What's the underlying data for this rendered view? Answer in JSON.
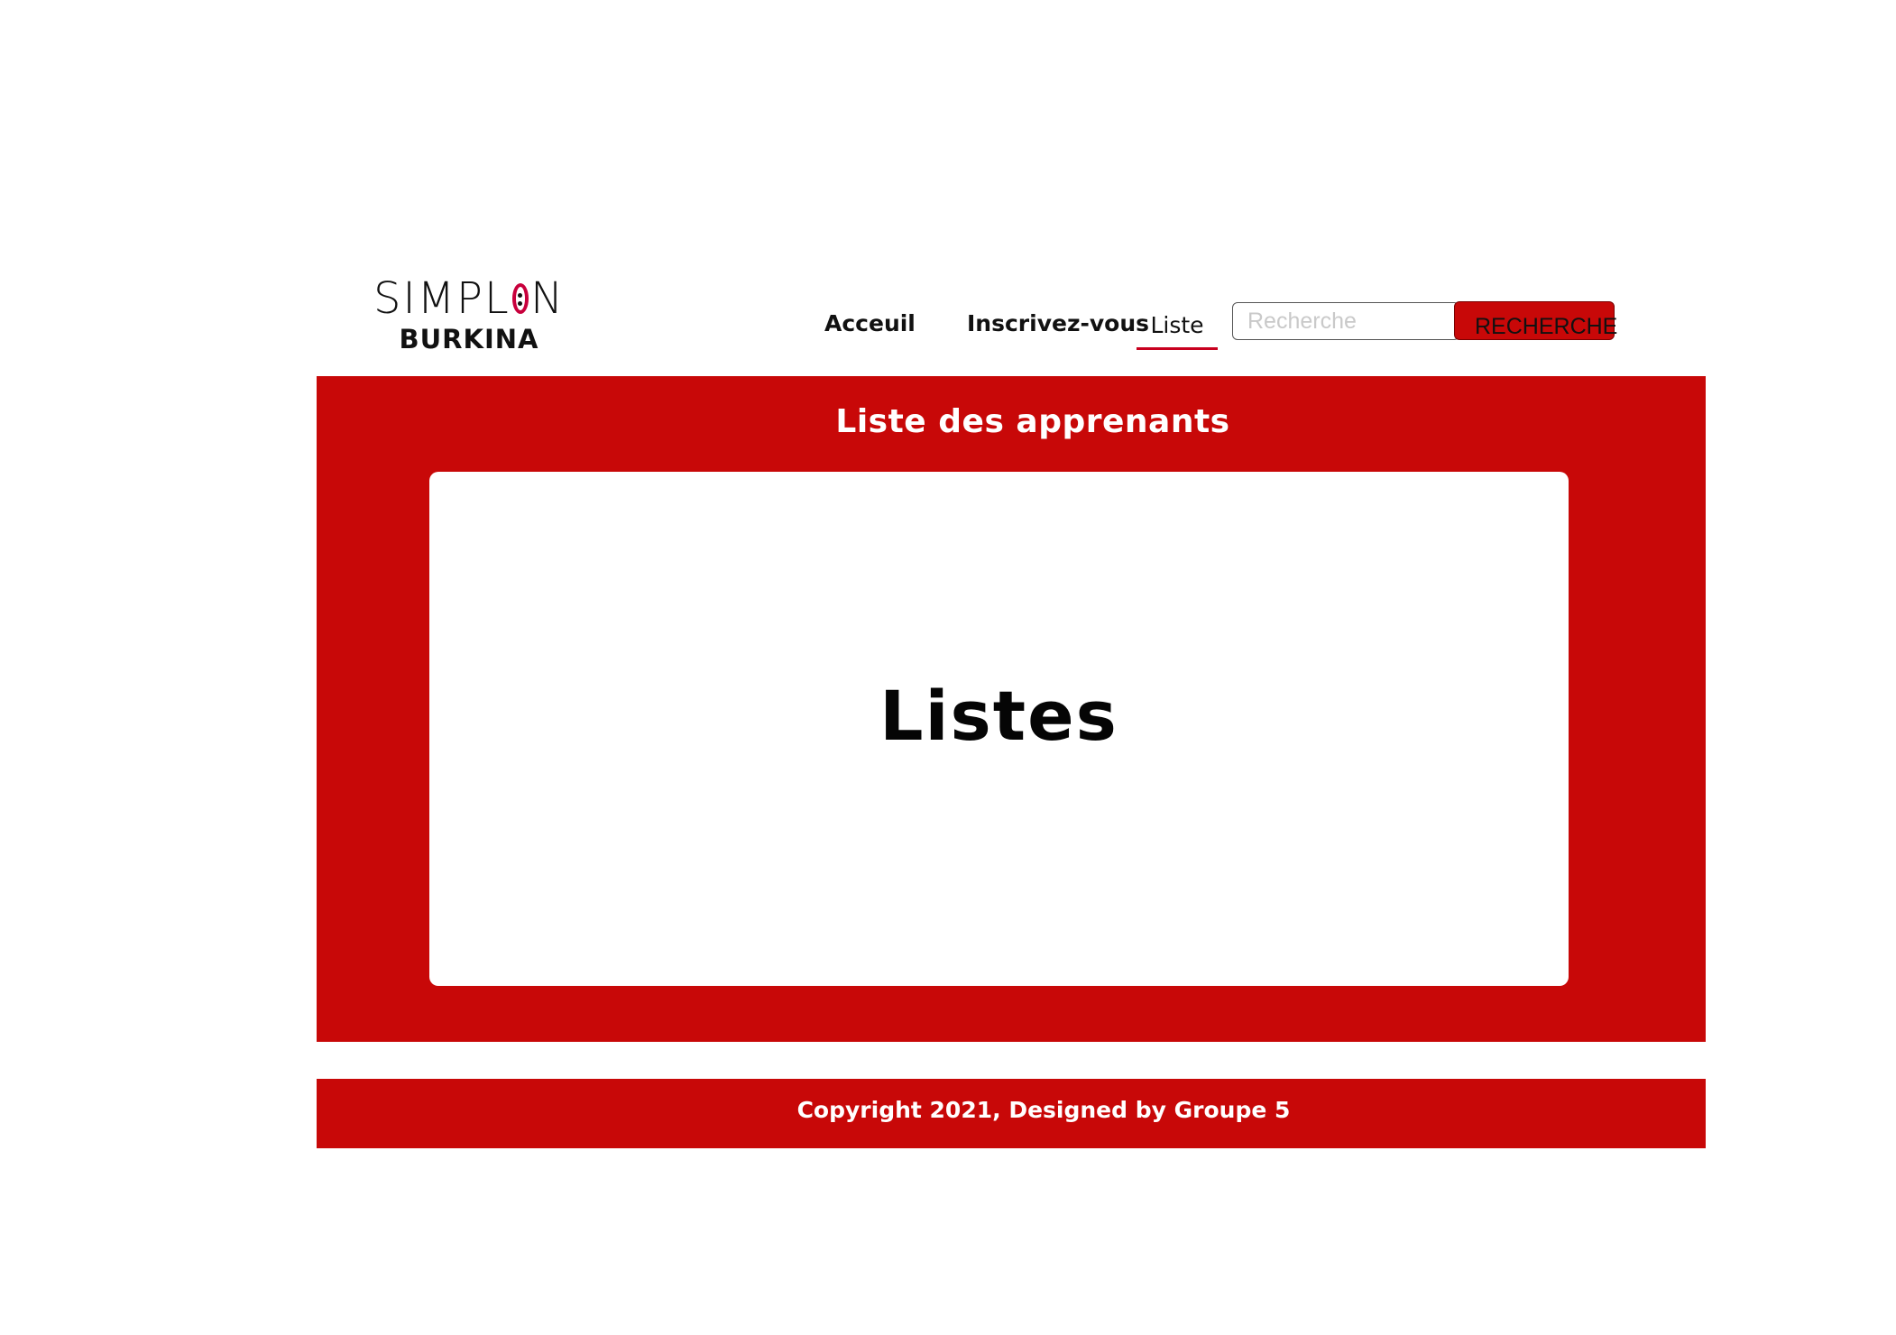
{
  "brand": {
    "logo_text_left": "SIMPL",
    "logo_text_right": "N",
    "logo_subtitle": "BURKINA",
    "accent_color": "#c8003c"
  },
  "nav": {
    "items": [
      {
        "label": "Acceuil",
        "active": false
      },
      {
        "label": "Inscrivez-vous",
        "active": false
      },
      {
        "label": "Liste",
        "active": true
      }
    ],
    "active_underline_color": "#c8001e"
  },
  "search": {
    "placeholder": "Recherche",
    "value": "",
    "button_label": "RECHERCHE"
  },
  "main": {
    "title": "Liste des apprenants",
    "card_title": "Listes",
    "background_color": "#c80808"
  },
  "footer": {
    "text": "Copyright 2021, Designed by Groupe 5",
    "background_color": "#c80808"
  }
}
